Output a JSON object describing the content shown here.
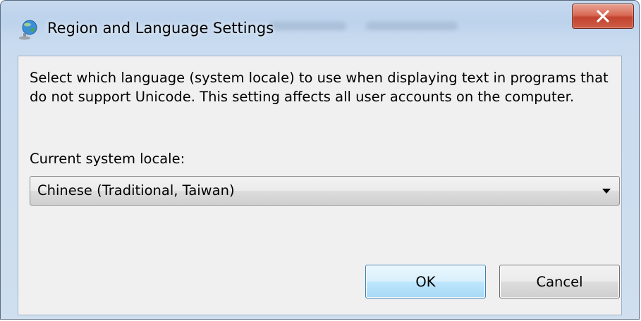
{
  "window": {
    "title": "Region and Language Settings",
    "close_label": "X"
  },
  "content": {
    "description": "Select which language (system locale) to use when displaying text in programs that do not support Unicode. This setting affects all user accounts on the computer.",
    "locale_label": "Current system locale:",
    "locale_select": {
      "selected": "Chinese (Traditional, Taiwan)"
    }
  },
  "buttons": {
    "ok_label": "OK",
    "cancel_label": "Cancel"
  },
  "icons": {
    "app": "globe-icon",
    "close": "close-icon",
    "dropdown": "chevron-down-icon"
  },
  "colors": {
    "close_button": "#c2432f",
    "ok_border": "#3c7fb1",
    "frame": "#c5d8ee"
  }
}
